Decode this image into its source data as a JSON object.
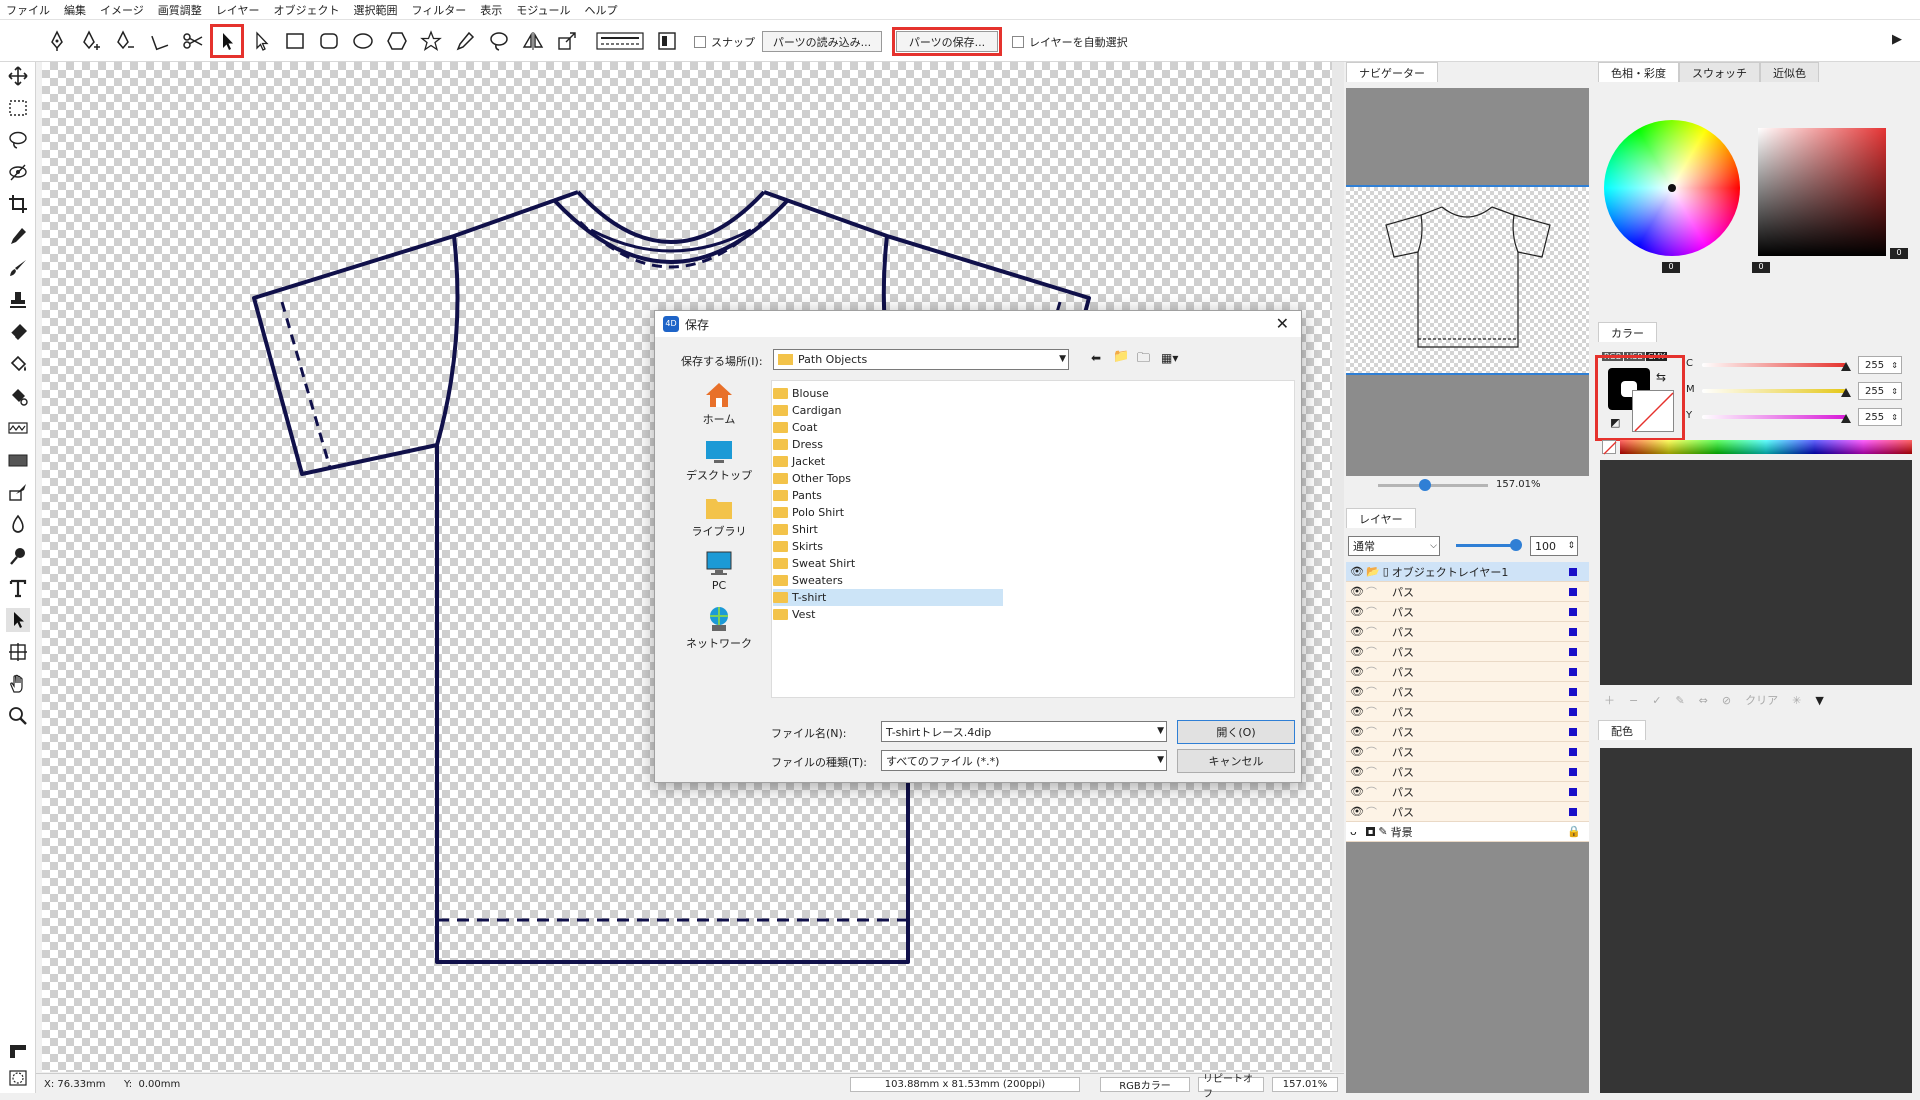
{
  "menu": [
    "ファイル",
    "編集",
    "イメージ",
    "画質調整",
    "レイヤー",
    "オブジェクト",
    "選択範囲",
    "フィルター",
    "表示",
    "モジュール",
    "ヘルプ"
  ],
  "toolbar": {
    "snap_label": "スナップ",
    "load_parts_label": "パーツの読み込み...",
    "save_parts_label": "パーツの保存...",
    "auto_select_label": "レイヤーを自動選択"
  },
  "status": {
    "x_label": "X:",
    "x_value": "76.33mm",
    "y_label": "Y:",
    "y_value": "0.00mm",
    "size": "103.88mm x 81.53mm (200ppi)",
    "color_mode": "RGBカラー",
    "repeat": "リピートオフ",
    "zoom": "157.01%"
  },
  "navigator": {
    "tab": "ナビゲーター",
    "zoom": "157.01%",
    "zoom_fraction": 0.43
  },
  "layers": {
    "tab": "レイヤー",
    "blend": "通常",
    "opacity": "100",
    "opacity_fraction": 1.0,
    "group": "オブジェクトレイヤー1",
    "paths": [
      "パス",
      "パス",
      "パス",
      "パス",
      "パス",
      "パス",
      "パス",
      "パス",
      "パス",
      "パス",
      "パス",
      "パス"
    ],
    "background": "背景"
  },
  "colorpanel": {
    "tabs": [
      "色相・彩度",
      "スウォッチ",
      "近似色"
    ],
    "wheel_value": "0",
    "square_value_left": "0",
    "square_value_right": "0"
  },
  "color": {
    "tab": "カラー",
    "modes": [
      "RGB",
      "HSB",
      "CMY"
    ],
    "channels": [
      {
        "label": "C",
        "value": "255",
        "fraction": 1.0
      },
      {
        "label": "M",
        "value": "255",
        "fraction": 1.0
      },
      {
        "label": "Y",
        "value": "255",
        "fraction": 1.0
      }
    ],
    "swatch_clear": "クリア"
  },
  "scheme": {
    "tab": "配色"
  },
  "dialog": {
    "title": "保存",
    "location_label": "保存する場所(I):",
    "location_value": "Path Objects",
    "places": [
      "ホーム",
      "デスクトップ",
      "ライブラリ",
      "PC",
      "ネットワーク"
    ],
    "folders": [
      "Blouse",
      "Cardigan",
      "Coat",
      "Dress",
      "Jacket",
      "Other Tops",
      "Pants",
      "Polo Shirt",
      "Shirt",
      "Skirts",
      "Sweat Shirt",
      "Sweaters",
      "T-shirt",
      "Vest"
    ],
    "selected_folder": "T-shirt",
    "filename_label": "ファイル名(N):",
    "filename_value": "T-shirtトレース.4dip",
    "filetype_label": "ファイルの種類(T):",
    "filetype_value": "すべてのファイル (*.*)",
    "open_label": "開く(O)",
    "cancel_label": "キャンセル"
  },
  "colors": {
    "accent": "#e5322d",
    "outline": "#10104a",
    "layer_swatch": "#1a10c8",
    "selection": "#cce4f7"
  }
}
